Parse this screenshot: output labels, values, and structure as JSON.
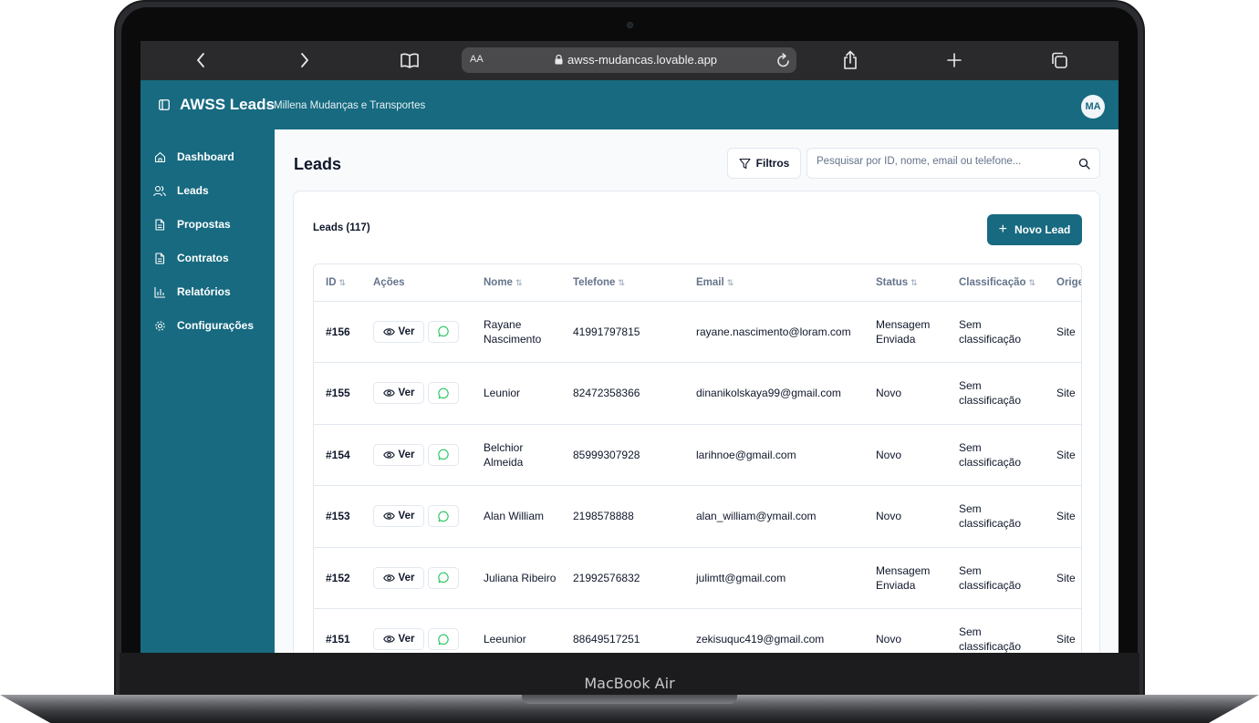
{
  "device": {
    "model": "MacBook Air"
  },
  "browser": {
    "text_size": "AA",
    "url": "awss-mudancas.lovable.app"
  },
  "header": {
    "brand": "AWSS Leads",
    "subtitle": "- Millena Mudanças e Transportes",
    "avatar": "MA"
  },
  "sidebar": {
    "items": [
      {
        "label": "Dashboard",
        "icon": "home-icon"
      },
      {
        "label": "Leads",
        "icon": "users-icon"
      },
      {
        "label": "Propostas",
        "icon": "file-icon"
      },
      {
        "label": "Contratos",
        "icon": "file-icon"
      },
      {
        "label": "Relatórios",
        "icon": "bar-chart-icon"
      },
      {
        "label": "Configurações",
        "icon": "gear-icon"
      }
    ]
  },
  "main": {
    "title": "Leads",
    "filter_label": "Filtros",
    "search_placeholder": "Pesquisar por ID, nome, email ou telefone...",
    "card_title": "Leads (117)",
    "new_button": "Novo Lead",
    "columns": [
      "ID",
      "Ações",
      "Nome",
      "Telefone",
      "Email",
      "Status",
      "Classificação",
      "Origem"
    ],
    "view_label": "Ver",
    "rows": [
      {
        "id": "#156",
        "name": "Rayane Nascimento",
        "phone": "41991797815",
        "email": "rayane.nascimento@loram.com",
        "status": "Mensagem Enviada",
        "class": "Sem classificação",
        "origin": "Site"
      },
      {
        "id": "#155",
        "name": "Leunior",
        "phone": "82472358366",
        "email": "dinanikolskaya99@gmail.com",
        "status": "Novo",
        "class": "Sem classificação",
        "origin": "Site"
      },
      {
        "id": "#154",
        "name": "Belchior Almeida",
        "phone": "85999307928",
        "email": "larihnoe@gmail.com",
        "status": "Novo",
        "class": "Sem classificação",
        "origin": "Site"
      },
      {
        "id": "#153",
        "name": "Alan William",
        "phone": "2198578888",
        "email": "alan_william@ymail.com",
        "status": "Novo",
        "class": "Sem classificação",
        "origin": "Site"
      },
      {
        "id": "#152",
        "name": "Juliana Ribeiro",
        "phone": "21992576832",
        "email": "julimtt@gmail.com",
        "status": "Mensagem Enviada",
        "class": "Sem classificação",
        "origin": "Site"
      },
      {
        "id": "#151",
        "name": "Leeunior",
        "phone": "88649517251",
        "email": "zekisuquc419@gmail.com",
        "status": "Novo",
        "class": "Sem classificação",
        "origin": "Site"
      }
    ]
  },
  "colors": {
    "primary": "#176a80",
    "whatsapp": "#22c55e"
  }
}
